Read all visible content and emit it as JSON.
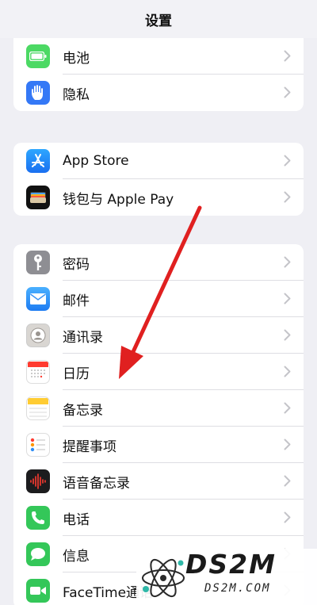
{
  "header": {
    "title": "设置"
  },
  "groups": [
    {
      "items": [
        {
          "label": "电池",
          "icon": "battery-icon"
        },
        {
          "label": "隐私",
          "icon": "hand-icon"
        }
      ]
    },
    {
      "items": [
        {
          "label": "App Store",
          "icon": "app-store-icon"
        },
        {
          "label": "钱包与 Apple Pay",
          "icon": "wallet-icon"
        }
      ]
    },
    {
      "items": [
        {
          "label": "密码",
          "icon": "key-icon"
        },
        {
          "label": "邮件",
          "icon": "mail-icon"
        },
        {
          "label": "通讯录",
          "icon": "contacts-icon"
        },
        {
          "label": "日历",
          "icon": "calendar-icon"
        },
        {
          "label": "备忘录",
          "icon": "notes-icon"
        },
        {
          "label": "提醒事项",
          "icon": "reminders-icon"
        },
        {
          "label": "语音备忘录",
          "icon": "voice-memos-icon"
        },
        {
          "label": "电话",
          "icon": "phone-icon"
        },
        {
          "label": "信息",
          "icon": "messages-icon"
        },
        {
          "label": "FaceTime通话",
          "icon": "facetime-icon"
        }
      ]
    }
  ],
  "watermark": {
    "main": "DS2M",
    "sub": "DS2M.COM"
  },
  "colors": {
    "background": "#efeff4",
    "battery": "#4cd964",
    "privacy": "#3478f6",
    "app_store": "#1a8cff",
    "key": "#8e8e93",
    "mail": "#2f8df5",
    "phone": "#34c759",
    "messages": "#34c759",
    "facetime": "#34c759",
    "arrow": "#e02020"
  }
}
